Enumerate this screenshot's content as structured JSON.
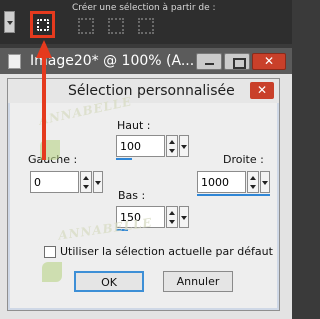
{
  "toolbar": {
    "caption": "Créer une sélection à partir de :"
  },
  "image_window": {
    "title": "Image20* @ 100% (A...",
    "close_symbol": "✕"
  },
  "dialog": {
    "title": "Sélection personnalisée",
    "close_symbol": "✕",
    "fields": {
      "haut": {
        "label": "Haut :",
        "value": "100"
      },
      "gauche": {
        "label": "Gauche :",
        "value": "0"
      },
      "droite": {
        "label": "Droite :",
        "value": "1000"
      },
      "bas": {
        "label": "Bas :",
        "value": "150"
      }
    },
    "checkbox_label": "Utiliser la  sélection actuelle par défaut",
    "checkbox_checked": false,
    "ok_label": "OK",
    "cancel_label": "Annuler"
  },
  "watermark": {
    "text": "ANNABELLE"
  },
  "colors": {
    "highlight": "#e53a1e",
    "accent": "#2f86d6"
  }
}
